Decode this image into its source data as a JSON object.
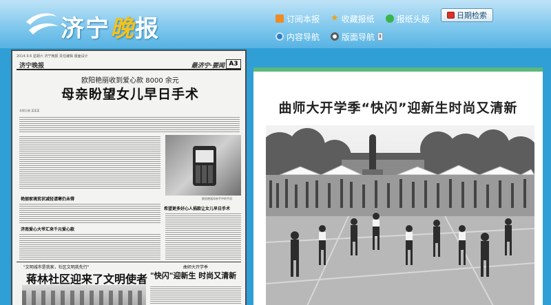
{
  "header": {
    "logo": {
      "name": "济宁晚报",
      "before": "济宁",
      "highlight": "晚",
      "after": "报"
    },
    "nav": {
      "row1": [
        {
          "id": "subscribe",
          "label": "订阅本报",
          "icon": "rss-icon",
          "color": "#f08a24"
        },
        {
          "id": "favorites",
          "label": "收藏报纸",
          "icon": "star-icon",
          "color": "#e8a31c"
        },
        {
          "id": "front",
          "label": "报纸头版",
          "icon": "dot-icon",
          "color": "#3bb34a"
        }
      ],
      "row2": [
        {
          "id": "content-nav",
          "label": "内容导航",
          "icon": "content-nav-icon",
          "color": "#2b7fc6"
        },
        {
          "id": "layout-nav",
          "label": "版面导航",
          "icon": "layout-nav-icon",
          "color": "#5a5a5a"
        }
      ]
    },
    "date_search": {
      "label": "日期检索",
      "icon": "calendar-icon"
    }
  },
  "newspaper": {
    "top_line": "2014.9.6 星期六  济宁晚报  责任编辑  版面设计",
    "masthead": "济宁晚报",
    "section": "最济宁·要闻",
    "page": "A3",
    "subheadline": "欧阳艳丽收到爱心款 8000 余元",
    "headline": "母亲盼望女儿早日手术",
    "byline": "本报记者 某某某",
    "kicker_1": "艳丽家境贫状减轻请寒仍未得",
    "kicker_2": "济南爱心大爷汇来千元爱心款",
    "kicker_3": "希望更多好心人捐款让女儿早日手术",
    "kicker_4": "\"文明城市是我家，社区文明我先行\"",
    "headline_2": "蒋林社区迎来了文明使者",
    "kicker_5": "曲师大开学季",
    "headline_3": "\"快闪\"迎新生 时尚又清新",
    "photo_caption": "欧阳艳丽母亲手中的手机"
  },
  "article": {
    "title": "曲师大开学季“快闪”迎新生时尚又清新"
  }
}
